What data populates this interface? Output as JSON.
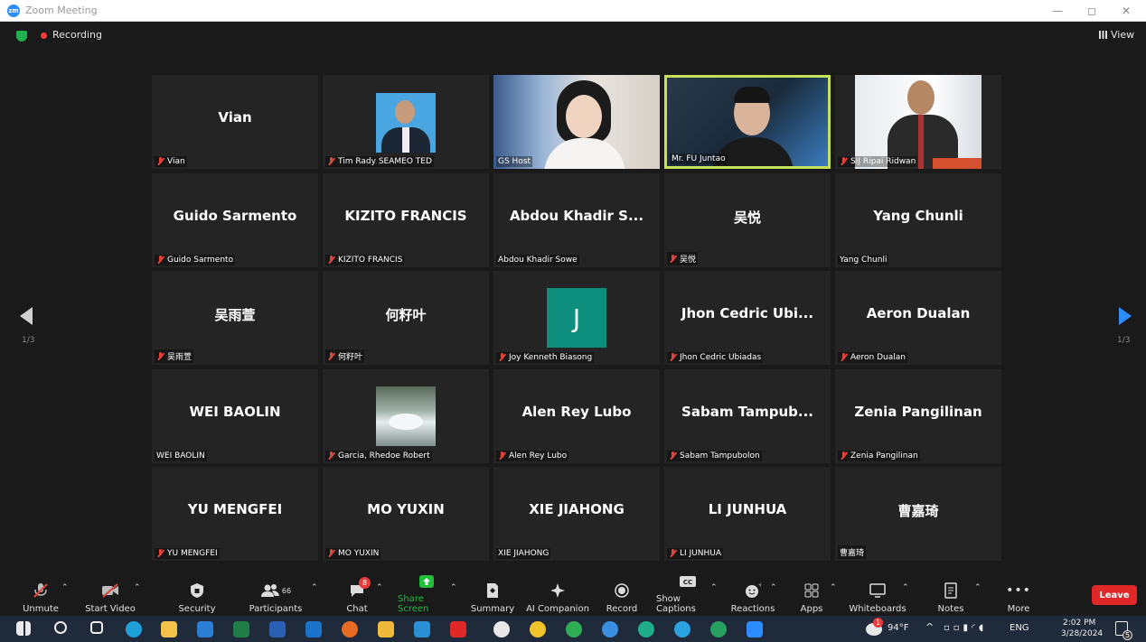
{
  "window": {
    "title": "Zoom Meeting"
  },
  "topbar": {
    "recording_label": "Recording",
    "view_label": "View"
  },
  "pager": {
    "left": "1/3",
    "right": "1/3"
  },
  "tiles": [
    {
      "name": "Vian",
      "label": "Vian",
      "muted": true
    },
    {
      "name": "",
      "label": "Tim Rady SEAMEO TED",
      "muted": true
    },
    {
      "name": "",
      "label": "GS Host",
      "muted": false
    },
    {
      "name": "",
      "label": "Mr. FU Juntao",
      "muted": false
    },
    {
      "name": "",
      "label": "SIJ Ripai Ridwan",
      "muted": true
    },
    {
      "name": "Guido Sarmento",
      "label": "Guido Sarmento",
      "muted": true
    },
    {
      "name": "KIZITO FRANCIS",
      "label": "KIZITO FRANCIS",
      "muted": true
    },
    {
      "name": "Abdou Khadir S...",
      "label": "Abdou Khadir Sowe",
      "muted": false
    },
    {
      "name": "吴悦",
      "label": "吴悦",
      "muted": true
    },
    {
      "name": "Yang Chunli",
      "label": "Yang Chunli",
      "muted": false
    },
    {
      "name": "吴雨萱",
      "label": "吴雨萱",
      "muted": true
    },
    {
      "name": "何籽叶",
      "label": "何籽叶",
      "muted": true
    },
    {
      "name": "J",
      "label": "Joy Kenneth Biasong",
      "muted": true
    },
    {
      "name": "Jhon Cedric Ubi...",
      "label": "Jhon Cedric Ubiadas",
      "muted": true
    },
    {
      "name": "Aeron Dualan",
      "label": "Aeron Dualan",
      "muted": true
    },
    {
      "name": "WEI BAOLIN",
      "label": "WEI BAOLIN",
      "muted": false
    },
    {
      "name": "",
      "label": "Garcia, Rhedoe Robert",
      "muted": true
    },
    {
      "name": "Alen Rey Lubo",
      "label": "Alen Rey Lubo",
      "muted": true
    },
    {
      "name": "Sabam Tampub...",
      "label": "Sabam Tampubolon",
      "muted": true
    },
    {
      "name": "Zenia Pangilinan",
      "label": "Zenia Pangilinan",
      "muted": true
    },
    {
      "name": "YU MENGFEI",
      "label": "YU MENGFEI",
      "muted": true
    },
    {
      "name": "MO YUXIN",
      "label": "MO YUXIN",
      "muted": true
    },
    {
      "name": "XIE JIAHONG",
      "label": "XIE JIAHONG",
      "muted": false
    },
    {
      "name": "LI JUNHUA",
      "label": "LI JUNHUA",
      "muted": true
    },
    {
      "name": "曹嘉琦",
      "label": "曹嘉琦",
      "muted": false
    }
  ],
  "toolbar": {
    "unmute": "Unmute",
    "start_video": "Start Video",
    "security": "Security",
    "participants": "Participants",
    "participants_count": "66",
    "chat": "Chat",
    "chat_badge": "8",
    "share_screen": "Share Screen",
    "summary": "Summary",
    "ai_companion": "AI Companion",
    "record": "Record",
    "show_captions": "Show Captions",
    "reactions": "Reactions",
    "apps": "Apps",
    "whiteboards": "Whiteboards",
    "notes": "Notes",
    "more": "More",
    "leave": "Leave"
  },
  "taskbar": {
    "temperature": "94°F",
    "language": "ENG",
    "time": "2:02 PM",
    "date": "3/28/2024",
    "notification_count": "5",
    "weather_badge": "1"
  },
  "colors": {
    "active_speaker": "#c6e05a",
    "leave": "#e02828",
    "share": "#1fbf3a",
    "accent": "#2d8cff",
    "avatar_j": "#0e8f7e"
  }
}
